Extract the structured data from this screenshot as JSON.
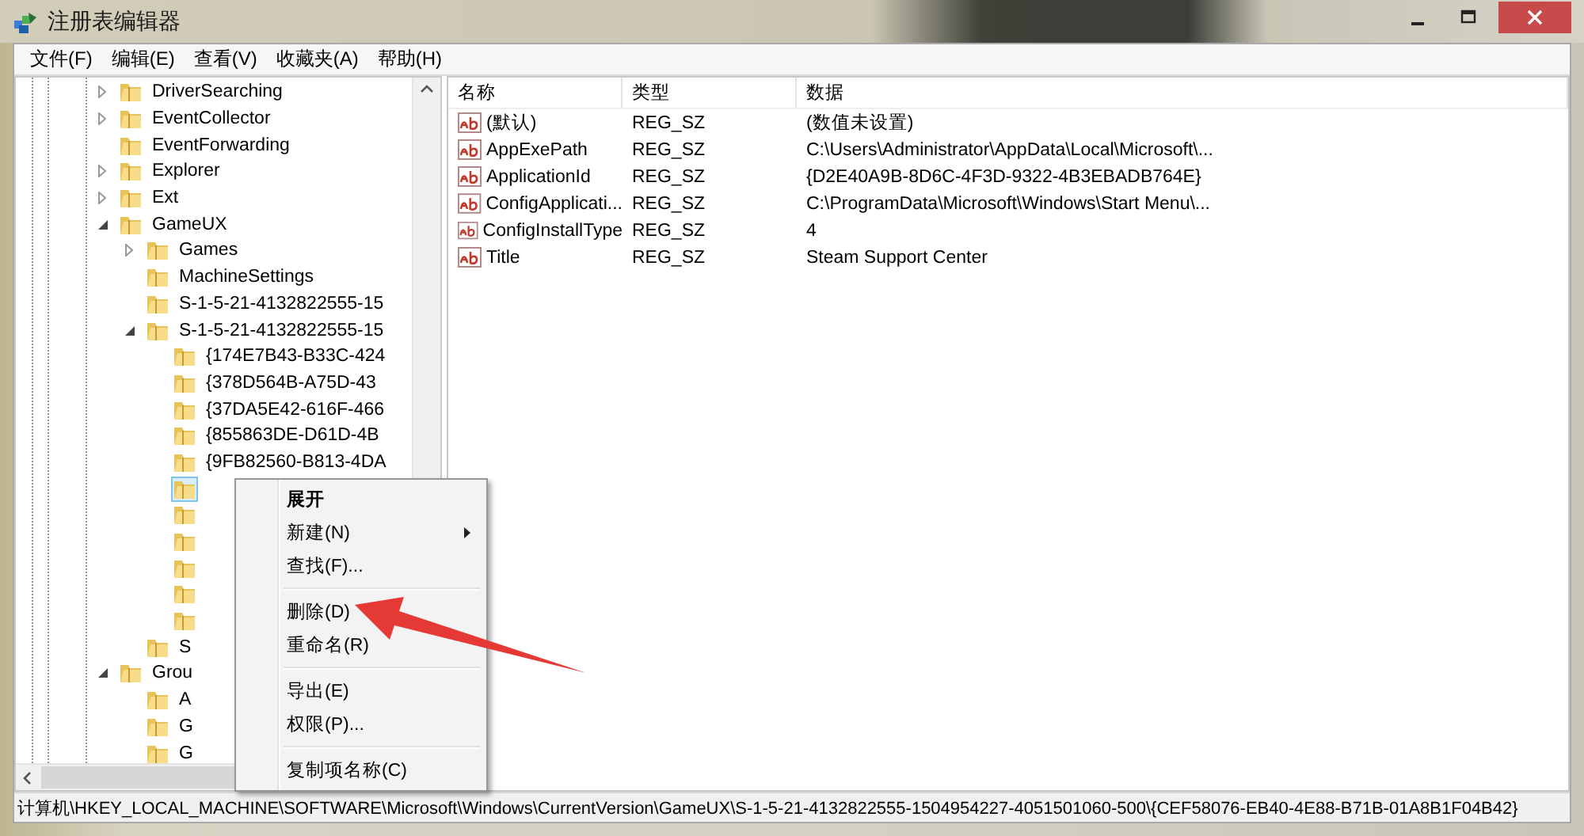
{
  "window": {
    "title": "注册表编辑器"
  },
  "menu_bar": [
    "文件(F)",
    "编辑(E)",
    "查看(V)",
    "收藏夹(A)",
    "帮助(H)"
  ],
  "tree": [
    {
      "label": "DriverSearching",
      "kind": "branch",
      "expanded": false,
      "selected": false
    },
    {
      "label": "EventCollector",
      "kind": "branch",
      "expanded": false,
      "selected": false
    },
    {
      "label": "EventForwarding",
      "kind": "leaf",
      "expanded": false,
      "selected": false
    },
    {
      "label": "Explorer",
      "kind": "branch",
      "expanded": false,
      "selected": false
    },
    {
      "label": "Ext",
      "kind": "branch",
      "expanded": false,
      "selected": false
    },
    {
      "label": "GameUX",
      "kind": "branch",
      "expanded": true,
      "selected": false,
      "children": [
        {
          "label": "Games",
          "kind": "branch",
          "expanded": false,
          "selected": false
        },
        {
          "label": "MachineSettings",
          "kind": "leaf",
          "expanded": false,
          "selected": false
        },
        {
          "label": "S-1-5-21-4132822555-15",
          "kind": "leaf",
          "expanded": false,
          "selected": false
        },
        {
          "label": "S-1-5-21-4132822555-15",
          "kind": "branch",
          "expanded": true,
          "selected": false,
          "children": [
            {
              "label": "{174E7B43-B33C-424",
              "kind": "leaf",
              "expanded": false,
              "selected": false
            },
            {
              "label": "{378D564B-A75D-43",
              "kind": "leaf",
              "expanded": false,
              "selected": false
            },
            {
              "label": "{37DA5E42-616F-466",
              "kind": "leaf",
              "expanded": false,
              "selected": false
            },
            {
              "label": "{855863DE-D61D-4B",
              "kind": "leaf",
              "expanded": false,
              "selected": false
            },
            {
              "label": "{9FB82560-B813-4DA",
              "kind": "leaf",
              "expanded": false,
              "selected": false
            },
            {
              "kind": "leaf",
              "expanded": false,
              "selected": true
            },
            {
              "kind": "leaf",
              "expanded": false,
              "selected": false
            },
            {
              "kind": "leaf",
              "expanded": false,
              "selected": false
            },
            {
              "kind": "leaf",
              "expanded": false,
              "selected": false
            },
            {
              "kind": "leaf",
              "expanded": false,
              "selected": false
            },
            {
              "kind": "leaf",
              "expanded": false,
              "selected": false
            }
          ]
        },
        {
          "label": "S",
          "kind": "leaf",
          "expanded": false,
          "selected": false
        }
      ]
    },
    {
      "label": "Grou",
      "kind": "branch",
      "expanded": true,
      "selected": false,
      "children": [
        {
          "label": "A",
          "kind": "leaf",
          "expanded": false,
          "selected": false
        },
        {
          "label": "G",
          "kind": "leaf",
          "expanded": false,
          "selected": false
        },
        {
          "label": "G",
          "kind": "leaf",
          "expanded": false,
          "selected": false
        }
      ]
    }
  ],
  "values_table": {
    "columns": [
      "名称",
      "类型",
      "数据"
    ],
    "rows": [
      {
        "name": "(默认)",
        "type": "REG_SZ",
        "data": "(数值未设置)"
      },
      {
        "name": "AppExePath",
        "type": "REG_SZ",
        "data": "C:\\Users\\Administrator\\AppData\\Local\\Microsoft\\..."
      },
      {
        "name": "ApplicationId",
        "type": "REG_SZ",
        "data": "{D2E40A9B-8D6C-4F3D-9322-4B3EBADB764E}"
      },
      {
        "name": "ConfigApplicati...",
        "type": "REG_SZ",
        "data": "C:\\ProgramData\\Microsoft\\Windows\\Start Menu\\..."
      },
      {
        "name": "ConfigInstallType",
        "type": "REG_SZ",
        "data": "4"
      },
      {
        "name": "Title",
        "type": "REG_SZ",
        "data": "Steam Support Center"
      }
    ]
  },
  "context_menu": [
    {
      "kind": "item",
      "label": "展开",
      "default": true,
      "submenu": false
    },
    {
      "kind": "item",
      "label": "新建(N)",
      "default": false,
      "submenu": true
    },
    {
      "kind": "item",
      "label": "查找(F)...",
      "default": false,
      "submenu": false
    },
    {
      "kind": "separator"
    },
    {
      "kind": "item",
      "label": "删除(D)",
      "default": false,
      "submenu": false
    },
    {
      "kind": "item",
      "label": "重命名(R)",
      "default": false,
      "submenu": false
    },
    {
      "kind": "separator"
    },
    {
      "kind": "item",
      "label": "导出(E)",
      "default": false,
      "submenu": false
    },
    {
      "kind": "item",
      "label": "权限(P)...",
      "default": false,
      "submenu": false
    },
    {
      "kind": "separator"
    },
    {
      "kind": "item",
      "label": "复制项名称(C)",
      "default": false,
      "submenu": false
    }
  ],
  "status_bar": "计算机\\HKEY_LOCAL_MACHINE\\SOFTWARE\\Microsoft\\Windows\\CurrentVersion\\GameUX\\S-1-5-21-4132822555-1504954227-4051501060-500\\{CEF58076-EB40-4E88-B71B-01A8B1F04B42}"
}
